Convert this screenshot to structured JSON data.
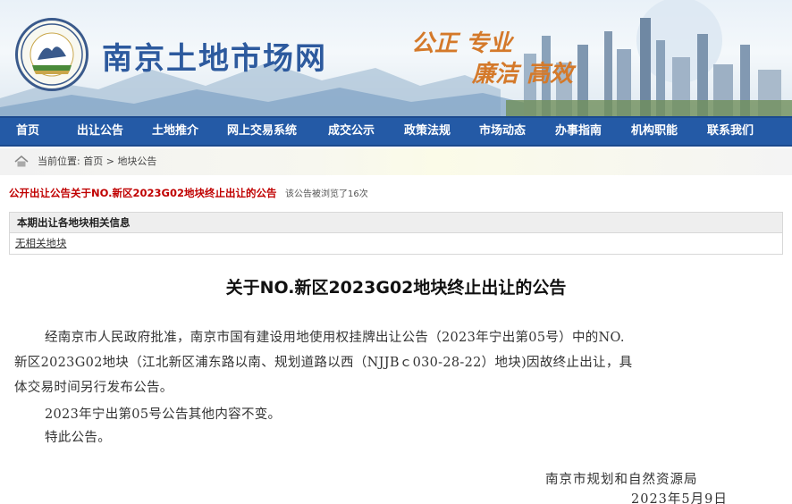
{
  "banner": {
    "site_title": "南京土地市场网",
    "slogan_line1": "公正  专业",
    "slogan_line2": "廉洁  高效"
  },
  "nav": {
    "items": [
      "首页",
      "出让公告",
      "土地推介",
      "网上交易系统",
      "成交公示",
      "政策法规",
      "市场动态",
      "办事指南",
      "机构职能",
      "联系我们"
    ]
  },
  "breadcrumb": {
    "prefix": "当前位置:",
    "home": "首页",
    "separator": ">",
    "current": "地块公告"
  },
  "notice": {
    "headline": "公开出让公告关于NO.新区2023G02地块终止出让的公告",
    "view_count": "该公告被浏览了16次"
  },
  "info_box": {
    "header": "本期出让各地块相关信息",
    "link": "无相关地块"
  },
  "article": {
    "title": "关于NO.新区2023G02地块终止出让的公告",
    "p1_line1": "经南京市人民政府批准，南京市国有建设用地使用权挂牌出让公告（2023年宁出第05号）中的NO.",
    "p1_line2": "新区2023G02地块（江北新区浦东路以南、规划道路以西（NJJBｃ030-28-22）地块)因故终止出让，具",
    "p1_line3": "体交易时间另行发布公告。",
    "p2": "2023年宁出第05号公告其他内容不变。",
    "p3": "特此公告。",
    "signature": "南京市规划和自然资源局",
    "date": "2023年5月9日"
  },
  "colors": {
    "nav_bg": "#245aa6",
    "headline_red": "#c00000",
    "title_blue": "#2d5a9e",
    "slogan_orange": "#d4792a"
  }
}
